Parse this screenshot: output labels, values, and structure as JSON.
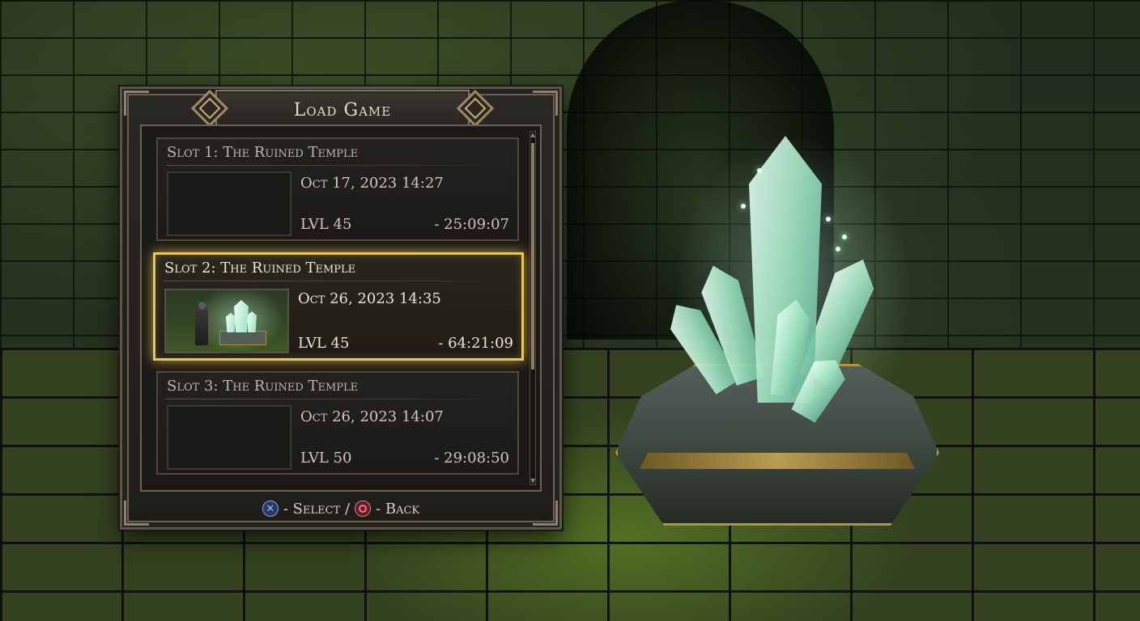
{
  "menu": {
    "title": "Load Game",
    "slots": [
      {
        "name": "Slot 1: The Ruined Temple",
        "date": "Oct 17, 2023 14:27",
        "level": "LVL 45",
        "playtime": "- 25:09:07",
        "has_thumbnail": false,
        "selected": false
      },
      {
        "name": "Slot 2: The Ruined Temple",
        "date": "Oct 26, 2023 14:35",
        "level": "LVL 45",
        "playtime": "- 64:21:09",
        "has_thumbnail": true,
        "selected": true
      },
      {
        "name": "Slot 3: The Ruined Temple",
        "date": "Oct 26, 2023 14:07",
        "level": "LVL 50",
        "playtime": "- 29:08:50",
        "has_thumbnail": false,
        "selected": false
      }
    ],
    "hint": {
      "select_icon": "cross-button-icon",
      "select_label": "- Select /",
      "back_icon": "circle-button-icon",
      "back_label": "- Back"
    }
  },
  "colors": {
    "selection_glow": "#e7c65a",
    "crystal": "#a9e6c9",
    "panel_bg": "#1f1d1a"
  }
}
